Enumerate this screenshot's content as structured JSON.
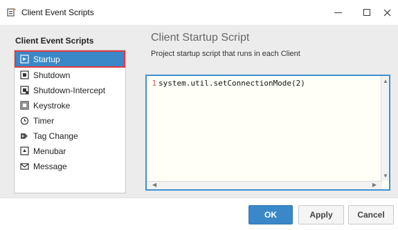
{
  "window": {
    "title": "Client Event Scripts",
    "controls": {
      "minimize": "—",
      "maximize": "☐",
      "close": "✕"
    }
  },
  "sidebar": {
    "header": "Client Event Scripts",
    "items": [
      {
        "label": "Startup",
        "icon": "startup-icon",
        "selected": true
      },
      {
        "label": "Shutdown",
        "icon": "shutdown-icon"
      },
      {
        "label": "Shutdown-Intercept",
        "icon": "shutdown-intercept-icon"
      },
      {
        "label": "Keystroke",
        "icon": "keystroke-icon"
      },
      {
        "label": "Timer",
        "icon": "timer-icon"
      },
      {
        "label": "Tag Change",
        "icon": "tag-change-icon"
      },
      {
        "label": "Menubar",
        "icon": "menubar-icon"
      },
      {
        "label": "Message",
        "icon": "message-icon"
      }
    ]
  },
  "main": {
    "title": "Client Startup Script",
    "description": "Project startup script that runs in each Client",
    "editor": {
      "line_number": "1",
      "code": "system.util.setConnectionMode(2)"
    }
  },
  "footer": {
    "ok_label": "OK",
    "apply_label": "Apply",
    "cancel_label": "Cancel"
  },
  "colors": {
    "accent": "#3a88c8",
    "highlight_outline": "#e5393f"
  }
}
